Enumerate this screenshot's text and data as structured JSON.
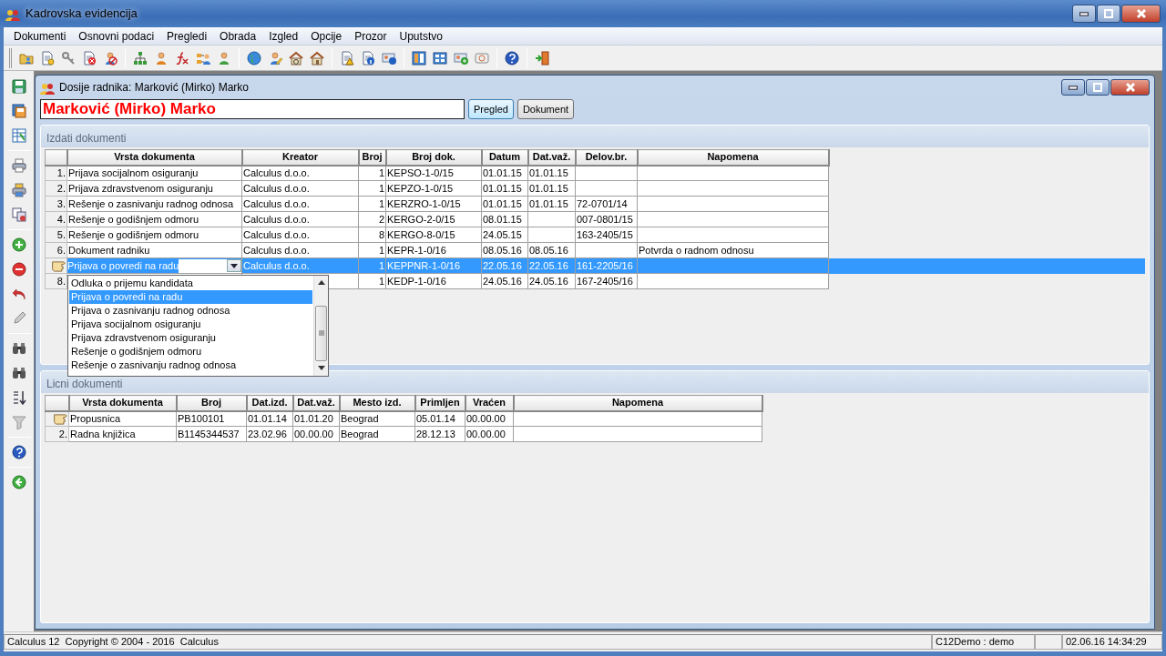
{
  "window": {
    "title": "Kadrovska evidencija"
  },
  "menu": [
    "Dokumenti",
    "Osnovni podaci",
    "Pregledi",
    "Obrada",
    "Izgled",
    "Opcije",
    "Prozor",
    "Uputstvo"
  ],
  "child_window": {
    "title": "Dosije radnika: Marković (Mirko) Marko",
    "name_field": {
      "value": "Marković (Mirko) Marko"
    },
    "buttons": [
      {
        "label": "Pregled",
        "focused": true
      },
      {
        "label": "Dokument",
        "focused": false
      }
    ]
  },
  "issued_documents": {
    "title": "Izdati dokumenti",
    "columns": [
      {
        "label": "Vrsta dokumenta",
        "kind": "text"
      },
      {
        "label": "Kreator",
        "kind": "text"
      },
      {
        "label": "Broj",
        "kind": "number"
      },
      {
        "label": "Broj dok.",
        "kind": "text"
      },
      {
        "label": "Datum",
        "kind": "text"
      },
      {
        "label": "Dat.važ.",
        "kind": "text"
      },
      {
        "label": "Delov.br.",
        "kind": "text"
      },
      {
        "label": "Napomena",
        "kind": "text"
      }
    ],
    "rows": [
      {
        "number": "1.",
        "current": false,
        "selected": false,
        "cells": [
          "Prijava socijalnom osiguranju",
          "Calculus d.o.o.",
          "1",
          "KEPSO-1-0/15",
          "01.01.15",
          "01.01.15",
          "",
          ""
        ]
      },
      {
        "number": "2.",
        "current": false,
        "selected": false,
        "cells": [
          "Prijava zdravstvenom osiguranju",
          "Calculus d.o.o.",
          "1",
          "KEPZO-1-0/15",
          "01.01.15",
          "01.01.15",
          "",
          ""
        ]
      },
      {
        "number": "3.",
        "current": false,
        "selected": false,
        "cells": [
          "Rešenje o zasnivanju radnog odnosa",
          "Calculus d.o.o.",
          "1",
          "KERZRO-1-0/15",
          "01.01.15",
          "01.01.15",
          "72-0701/14",
          ""
        ]
      },
      {
        "number": "4.",
        "current": false,
        "selected": false,
        "cells": [
          "Rešenje o godišnjem odmoru",
          "Calculus d.o.o.",
          "2",
          "KERGO-2-0/15",
          "08.01.15",
          "",
          "007-0801/15",
          ""
        ]
      },
      {
        "number": "5.",
        "current": false,
        "selected": false,
        "cells": [
          "Rešenje o godišnjem odmoru",
          "Calculus d.o.o.",
          "8",
          "KERGO-8-0/15",
          "24.05.15",
          "",
          "163-2405/15",
          ""
        ]
      },
      {
        "number": "6.",
        "current": false,
        "selected": false,
        "cells": [
          "Dokument radniku",
          "Calculus d.o.o.",
          "1",
          "KEPR-1-0/16",
          "08.05.16",
          "08.05.16",
          "",
          "Potvrda o radnom odnosu"
        ]
      },
      {
        "current": true,
        "selected": true,
        "cells": [
          "Prijava o povredi na radu",
          "Calculus d.o.o.",
          "1",
          "KEPPNR-1-0/16",
          "22.05.16",
          "22.05.16",
          "161-2205/16",
          ""
        ],
        "dropdown": {
          "options": [
            {
              "label": "Odluka o prijemu kandidata",
              "selected": false
            },
            {
              "label": "Prijava o povredi na radu",
              "selected": true
            },
            {
              "label": "Prijava o zasnivanju radnog odnosa",
              "selected": false
            },
            {
              "label": "Prijava socijalnom osiguranju",
              "selected": false
            },
            {
              "label": "Prijava zdravstvenom osiguranju",
              "selected": false
            },
            {
              "label": "Rešenje o godišnjem odmoru",
              "selected": false
            },
            {
              "label": "Rešenje o zasnivanju radnog odnosa",
              "selected": false
            }
          ]
        }
      },
      {
        "number": "8.",
        "current": false,
        "selected": false,
        "cells": [
          "",
          "",
          "1",
          "KEDP-1-0/16",
          "24.05.16",
          "24.05.16",
          "167-2405/16",
          ""
        ]
      }
    ]
  },
  "personal_documents": {
    "title": "Licni dokumenti",
    "columns": [
      {
        "label": "Vrsta dokumenta"
      },
      {
        "label": "Broj"
      },
      {
        "label": "Dat.izd."
      },
      {
        "label": "Dat.važ."
      },
      {
        "label": "Mesto izd."
      },
      {
        "label": "Primljen"
      },
      {
        "label": "Vraćen"
      },
      {
        "label": "Napomena"
      }
    ],
    "rows": [
      {
        "current": true,
        "selected": false,
        "cells": [
          "Propusnica",
          "PB100101",
          "01.01.14",
          "01.01.20",
          "Beograd",
          "05.01.14",
          "00.00.00",
          ""
        ]
      },
      {
        "number": "2.",
        "current": false,
        "selected": false,
        "cells": [
          "Radna knjižica",
          "B1145344537",
          "23.02.96",
          "00.00.00",
          "Beograd",
          "28.12.13",
          "00.00.00",
          ""
        ]
      }
    ]
  },
  "status_bar": {
    "left": "Calculus 12  Copyright © 2004 - 2016  Calculus",
    "user": "C12Demo : demo",
    "datetime": "02.06.16 14:34:29"
  }
}
